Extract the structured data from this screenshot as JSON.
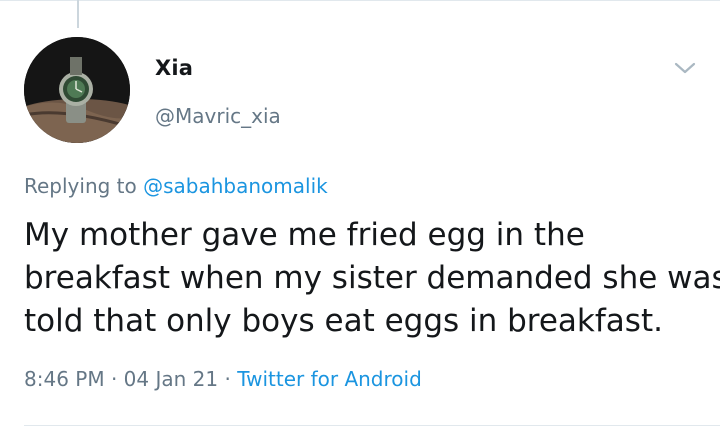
{
  "user": {
    "display_name": "Xia",
    "handle": "@Mavric_xia",
    "avatar_icon": "wristwatch-photo"
  },
  "reply": {
    "prefix": "Replying to",
    "mention": "@sabahbanomalik"
  },
  "tweet": {
    "lines": [
      "My mother gave me fried egg in the",
      "breakfast when my sister demanded she was",
      "told that only boys eat eggs in breakfast."
    ]
  },
  "meta": {
    "time": "8:46 PM",
    "date": "04 Jan 21",
    "source": "Twitter for Android",
    "separator": "·"
  },
  "colors": {
    "link": "#1b95e0",
    "secondary_text": "#657786",
    "primary_text": "#14171a"
  },
  "icons": {
    "menu": "chevron-down-icon"
  }
}
